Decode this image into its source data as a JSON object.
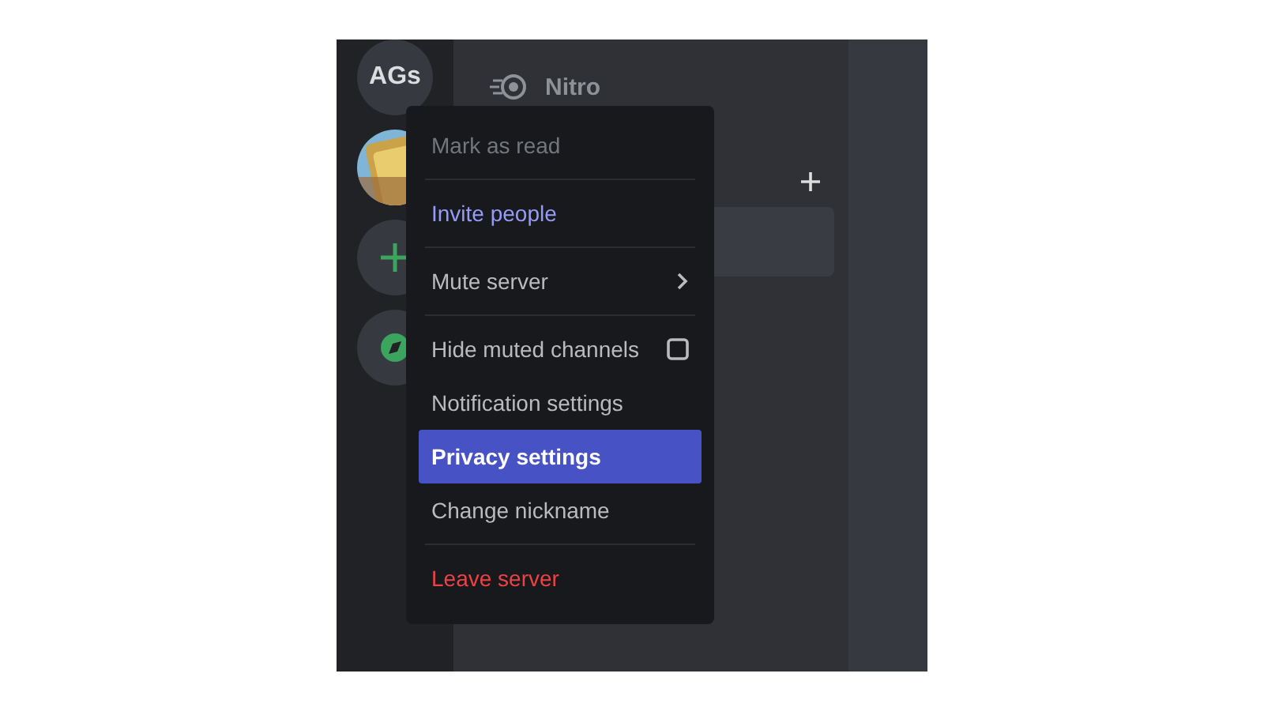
{
  "servers": [
    {
      "kind": "initials",
      "label": "AGs"
    },
    {
      "kind": "picture"
    },
    {
      "kind": "add"
    },
    {
      "kind": "explore"
    }
  ],
  "channel_list": {
    "nitro": {
      "label": "Nitro"
    }
  },
  "context_menu": {
    "items": [
      {
        "label": "Mark as read",
        "kind": "item",
        "color": "#72767d",
        "selected": false
      },
      {
        "kind": "divider"
      },
      {
        "label": "Invite people",
        "kind": "item",
        "color": "#949cf7",
        "selected": false
      },
      {
        "kind": "divider"
      },
      {
        "label": "Mute server",
        "kind": "submenu",
        "color": "#b9bbbe",
        "selected": false
      },
      {
        "kind": "divider"
      },
      {
        "label": "Hide muted channels",
        "kind": "checkbox",
        "checked": false,
        "color": "#b9bbbe",
        "selected": false
      },
      {
        "label": "Notification settings",
        "kind": "item",
        "color": "#b9bbbe",
        "selected": false
      },
      {
        "label": "Privacy settings",
        "kind": "item",
        "color": "#ffffff",
        "selected": true
      },
      {
        "label": "Change nickname",
        "kind": "item",
        "color": "#b9bbbe",
        "selected": false
      },
      {
        "kind": "divider"
      },
      {
        "label": "Leave server",
        "kind": "item",
        "color": "#ed4245",
        "selected": false
      }
    ]
  }
}
